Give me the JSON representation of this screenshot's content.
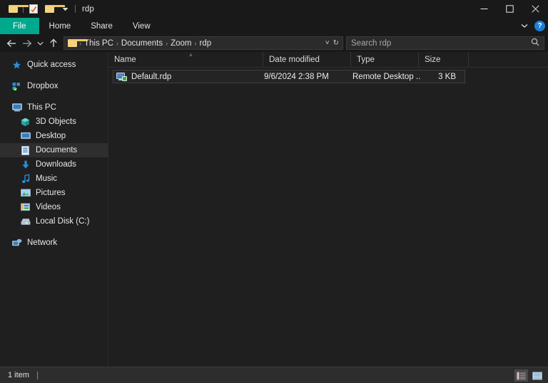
{
  "window": {
    "title": "rdp",
    "quick_access_toolbar": [
      {
        "name": "folder-icon",
        "label": "Folder"
      },
      {
        "name": "properties-icon",
        "label": "Properties"
      },
      {
        "name": "new-folder-icon",
        "label": "New folder"
      },
      {
        "name": "customize-chevron-icon",
        "label": "Customize Quick Access Toolbar"
      }
    ],
    "controls": {
      "minimize": "─",
      "maximize": "□",
      "close": "✕"
    }
  },
  "ribbon": {
    "tabs": [
      {
        "label": "File",
        "active": true
      },
      {
        "label": "Home",
        "active": false
      },
      {
        "label": "Share",
        "active": false
      },
      {
        "label": "View",
        "active": false
      }
    ],
    "expand_icon": "chevron-down-icon",
    "help_label": "?",
    "accent_color": "#00a88e"
  },
  "address_bar": {
    "back_label": "←",
    "forward_label": "→",
    "recent_label": "˅",
    "up_label": "↑",
    "breadcrumbs": [
      "This PC",
      "Documents",
      "Zoom",
      "rdp"
    ],
    "separator": "›",
    "dropdown_label": "˅",
    "refresh_label": "↻"
  },
  "search": {
    "placeholder": "Search rdp",
    "icon": "search-icon"
  },
  "sidebar": {
    "items": [
      {
        "label": "Quick access",
        "icon": "star-icon",
        "indent": false,
        "selected": false
      },
      {
        "label": "Dropbox",
        "icon": "dropbox-icon",
        "indent": false,
        "selected": false
      },
      {
        "label": "This PC",
        "icon": "computer-icon",
        "indent": false,
        "selected": false
      },
      {
        "label": "3D Objects",
        "icon": "cube-icon",
        "indent": true,
        "selected": false
      },
      {
        "label": "Desktop",
        "icon": "desktop-icon",
        "indent": true,
        "selected": false
      },
      {
        "label": "Documents",
        "icon": "documents-icon",
        "indent": true,
        "selected": true
      },
      {
        "label": "Downloads",
        "icon": "download-icon",
        "indent": true,
        "selected": false
      },
      {
        "label": "Music",
        "icon": "music-icon",
        "indent": true,
        "selected": false
      },
      {
        "label": "Pictures",
        "icon": "pictures-icon",
        "indent": true,
        "selected": false
      },
      {
        "label": "Videos",
        "icon": "videos-icon",
        "indent": true,
        "selected": false
      },
      {
        "label": "Local Disk (C:)",
        "icon": "disk-icon",
        "indent": true,
        "selected": false
      },
      {
        "label": "Network",
        "icon": "network-icon",
        "indent": false,
        "selected": false
      }
    ]
  },
  "file_list": {
    "columns": [
      {
        "label": "Name",
        "sorted": "ascending"
      },
      {
        "label": "Date modified",
        "sorted": ""
      },
      {
        "label": "Type",
        "sorted": ""
      },
      {
        "label": "Size",
        "sorted": ""
      }
    ],
    "rows": [
      {
        "name": "Default.rdp",
        "date_modified": "9/6/2024 2:38 PM",
        "type": "Remote Desktop ...",
        "size": "3 KB",
        "icon": "rdp-file-icon",
        "selected": true
      }
    ]
  },
  "status_bar": {
    "item_count": "1 item",
    "view_buttons": [
      {
        "name": "details-view-button",
        "active": true
      },
      {
        "name": "large-icons-view-button",
        "active": false
      }
    ]
  }
}
